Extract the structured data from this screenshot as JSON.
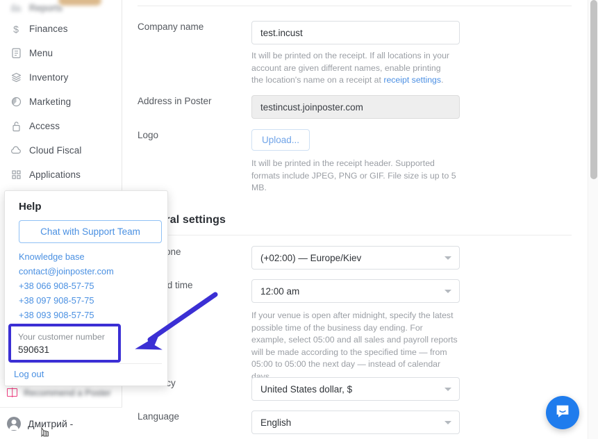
{
  "sidebar": {
    "items": [
      {
        "label": "Reports",
        "icon": "bar-chart-icon",
        "blurred": true
      },
      {
        "label": "Finances",
        "icon": "dollar-icon",
        "blurred": false
      },
      {
        "label": "Menu",
        "icon": "menu-book-icon",
        "blurred": false
      },
      {
        "label": "Inventory",
        "icon": "layers-icon",
        "blurred": false
      },
      {
        "label": "Marketing",
        "icon": "pie-chart-icon",
        "blurred": false
      },
      {
        "label": "Access",
        "icon": "lock-icon",
        "blurred": false
      },
      {
        "label": "Cloud Fiscal",
        "icon": "cloud-icon",
        "blurred": false
      },
      {
        "label": "Applications",
        "icon": "grid-icon",
        "blurred": false
      }
    ],
    "recommend": {
      "label": "Recommend a Poster",
      "icon": "gift-icon"
    },
    "user": {
      "name": "Дмитрий -",
      "icon": "avatar-icon"
    }
  },
  "main": {
    "company_name": {
      "label": "Company name",
      "value": "test.incust",
      "hint_before": "It will be printed on the receipt. If all locations in your account are given different names, enable printing the location's name on a receipt at ",
      "hint_link": "receipt settings",
      "hint_after": "."
    },
    "address": {
      "label": "Address in Poster",
      "value": "testincust.joinposter.com"
    },
    "logo": {
      "label": "Logo",
      "upload_label": "Upload...",
      "hint": "It will be printed in the receipt header. Supported formats include JPEG, PNG or GIF. File size is up to 5 MB."
    },
    "general_settings": {
      "title": "General settings",
      "timezone": {
        "label": "Time zone",
        "value": "(+02:00) — Europe/Kiev"
      },
      "day_end_time": {
        "label": "Day end time",
        "value": "12:00 am",
        "hint": "If your venue is open after midnight, specify the latest possible time of the business day ending. For example, select 05:00 and all sales and payroll reports will be made according to the specified time — from 05:00 to 05:00 the next day — instead of calendar days."
      },
      "currency": {
        "label": "Currency",
        "value": "United States dollar, $"
      },
      "language": {
        "label": "Language",
        "value": "English"
      }
    }
  },
  "help_popup": {
    "title": "Help",
    "chat_button": "Chat with Support Team",
    "links": [
      "Knowledge base",
      "contact@joinposter.com",
      "+38 066 908-57-75",
      "+38 097 908-57-75",
      "+38 093 908-57-75"
    ],
    "customer_number": {
      "caption": "Your customer number",
      "value": "590631"
    },
    "logout": "Log out"
  },
  "chat_widget": {
    "icon": "intercom-chat-icon"
  },
  "annotation": {
    "type": "arrow",
    "color": "#3b2fd4"
  },
  "colors": {
    "accent_link": "#4a90e2",
    "highlight_border": "#3b2fd4",
    "chat_fab": "#1f7ced",
    "gift_icon": "#ee3e80"
  }
}
